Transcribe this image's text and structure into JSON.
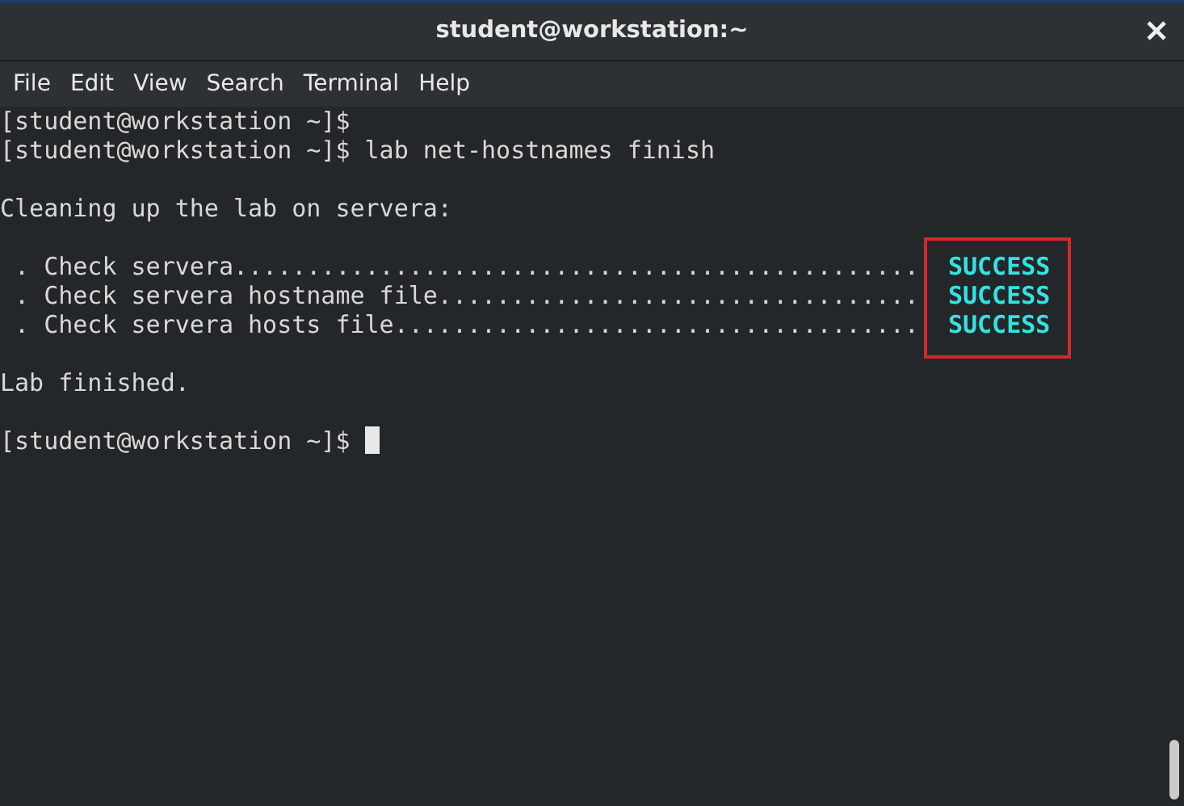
{
  "window": {
    "title": "student@workstation:~"
  },
  "menu": [
    "File",
    "Edit",
    "View",
    "Search",
    "Terminal",
    "Help"
  ],
  "terminal": {
    "status_highlight": true,
    "lines": [
      {
        "kind": "prompt",
        "prompt": "[student@workstation ~]$",
        "cursor": false
      },
      {
        "kind": "prompt",
        "prompt": "[student@workstation ~]$",
        "command": "lab net-hostnames finish",
        "cursor": false
      },
      {
        "kind": "blank"
      },
      {
        "kind": "output",
        "text": "Cleaning up the lab on servera:"
      },
      {
        "kind": "blank"
      },
      {
        "kind": "check",
        "label": " . Check servera...............................................",
        "status": "SUCCESS"
      },
      {
        "kind": "check",
        "label": " . Check servera hostname file.................................",
        "status": "SUCCESS"
      },
      {
        "kind": "check",
        "label": " . Check servera hosts file....................................",
        "status": "SUCCESS"
      },
      {
        "kind": "blank"
      },
      {
        "kind": "output",
        "text": "Lab finished."
      },
      {
        "kind": "blank"
      },
      {
        "kind": "prompt",
        "prompt": "[student@workstation ~]$",
        "cursor": true
      }
    ]
  }
}
